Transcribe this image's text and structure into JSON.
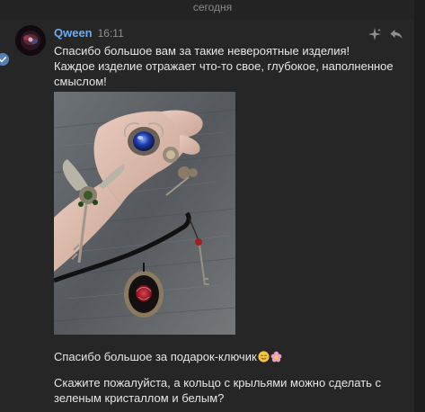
{
  "date_separator": "сегодня",
  "message": {
    "author": "Qween",
    "time": "16:11",
    "text_1_line_1": "Спасибо большое вам за такие невероятные изделия!",
    "text_1_line_2": "Каждое изделие отражает что-то свое, глубокое, наполненное смыслом!",
    "text_2": "Спасибо большое за подарок-ключик",
    "text_3": "Скажите пожалуйста, а кольцо с крыльями можно сделать с зеленым кристаллом и белым?",
    "icons": {
      "status": "check-circle-icon",
      "favorite": "sparkle-star-icon",
      "reply": "reply-arrow-icon",
      "emoji_1": "smiling-face-emoji",
      "emoji_2": "blossom-emoji"
    }
  },
  "colors": {
    "background": "#232323",
    "message_bg": "#262626",
    "author": "#71aaeb",
    "text": "#e6e6e6",
    "muted": "#8f8f8f"
  }
}
